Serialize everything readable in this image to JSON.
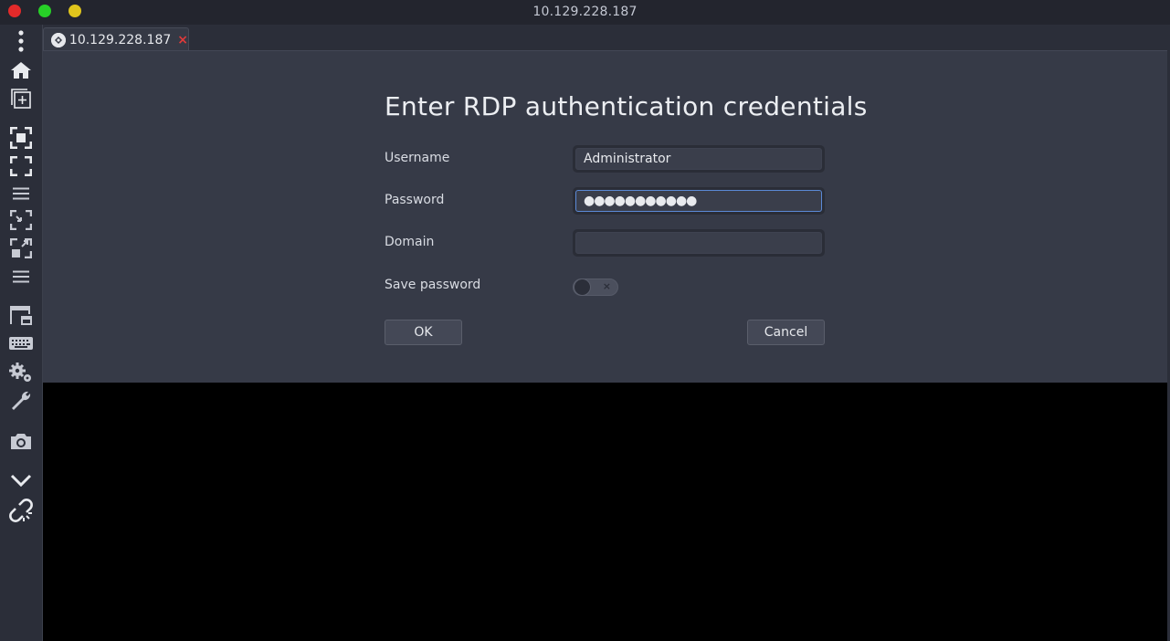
{
  "window": {
    "title": "10.129.228.187"
  },
  "sidebar": {
    "items": [
      {
        "name": "menu",
        "icon": "kebab-menu-icon"
      },
      {
        "name": "home",
        "icon": "home-icon"
      },
      {
        "name": "new-connection",
        "icon": "new-tab-icon"
      },
      {
        "name": "fit-window",
        "icon": "fit-window-icon"
      },
      {
        "name": "fullscreen",
        "icon": "fullscreen-icon"
      },
      {
        "name": "menu-2",
        "icon": "menu-icon"
      },
      {
        "name": "scale",
        "icon": "scale-icon"
      },
      {
        "name": "dynamic-resolution",
        "icon": "resize-icon"
      },
      {
        "name": "menu-3",
        "icon": "menu-icon"
      },
      {
        "name": "multi-monitor",
        "icon": "multi-monitor-icon"
      },
      {
        "name": "keyboard",
        "icon": "keyboard-icon"
      },
      {
        "name": "preferences",
        "icon": "gears-icon"
      },
      {
        "name": "tools",
        "icon": "wrench-icon"
      },
      {
        "name": "screenshot",
        "icon": "camera-icon"
      },
      {
        "name": "minimize",
        "icon": "chevron-down-icon"
      },
      {
        "name": "disconnect",
        "icon": "broken-link-icon"
      }
    ]
  },
  "tab": {
    "label": "10.129.228.187",
    "close": "×"
  },
  "dialog": {
    "title": "Enter RDP authentication credentials",
    "username_label": "Username",
    "username_value": "Administrator",
    "password_label": "Password",
    "password_value": "●●●●●●●●●●●",
    "domain_label": "Domain",
    "domain_value": "",
    "save_password_label": "Save password",
    "save_password_on": false,
    "toggle_mark": "×",
    "ok_label": "OK",
    "cancel_label": "Cancel"
  },
  "colors": {
    "traffic_red": "#e32a2a",
    "traffic_green": "#27d027",
    "traffic_yellow": "#e0c51c",
    "tab_close": "#e03a3a",
    "focus_border": "#5b89d6"
  }
}
